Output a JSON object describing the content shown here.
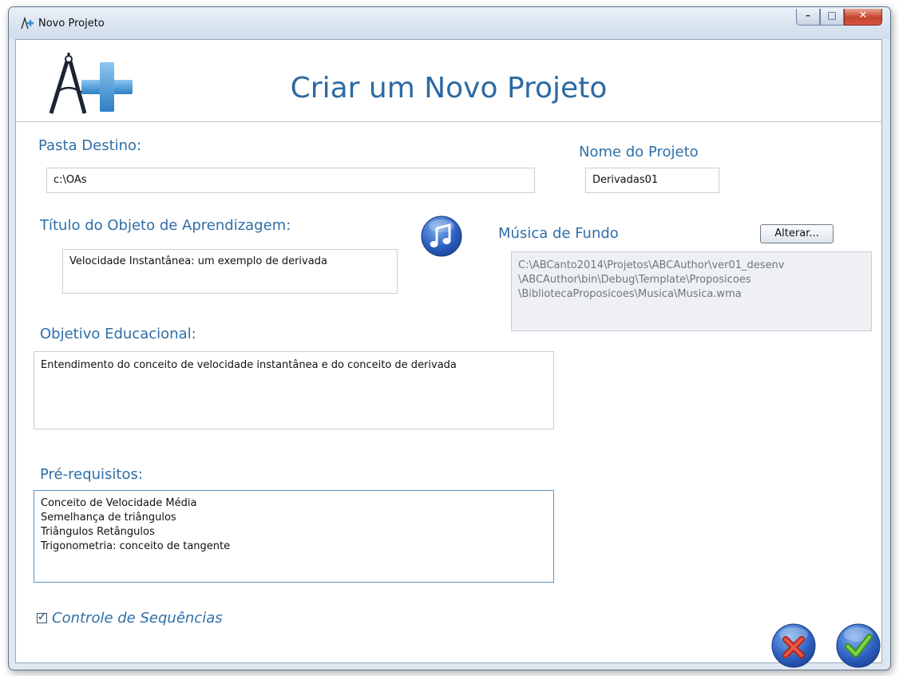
{
  "window": {
    "title": "Novo Projeto",
    "controls": {
      "minimize": "–",
      "maximize": "□",
      "close": "✕"
    }
  },
  "header": {
    "title": "Criar um Novo Projeto",
    "logo_icon": "compass-plus-logo"
  },
  "form": {
    "destination_folder": {
      "label": "Pasta Destino:",
      "value": "c:\\OAs"
    },
    "project_name": {
      "label": "Nome do Projeto",
      "value": "Derivadas01"
    },
    "learning_object_title": {
      "label": "Título do Objeto de Aprendizagem:",
      "value": "Velocidade Instantânea: um exemplo de derivada"
    },
    "background_music": {
      "label": "Música de Fundo",
      "change_button": "Alterar...",
      "path": "C:\\ABCanto2014\\Projetos\\ABCAuthor\\ver01_desenv\n\\ABCAuthor\\bin\\Debug\\Template\\Proposicoes\n\\BibliotecaProposicoes\\Musica\\Musica.wma"
    },
    "educational_goal": {
      "label": "Objetivo Educacional:",
      "value": "Entendimento do conceito de velocidade instantânea e do conceito de derivada"
    },
    "prerequisites": {
      "label": "Pré-requisitos:",
      "value": "Conceito de Velocidade Média\nSemelhança de triângulos\nTriângulos Retângulos\nTrigonometria: conceito de tangente"
    },
    "sequence_control": {
      "label": "Controle de Sequências",
      "checked": true
    }
  },
  "actions": {
    "cancel_icon": "cancel-x-icon",
    "confirm_icon": "confirm-check-icon"
  },
  "colors": {
    "label_blue": "#2f6ea8",
    "title_blue": "#2b6aa3",
    "close_red": "#c7432c",
    "confirm_green": "#58b82e"
  }
}
